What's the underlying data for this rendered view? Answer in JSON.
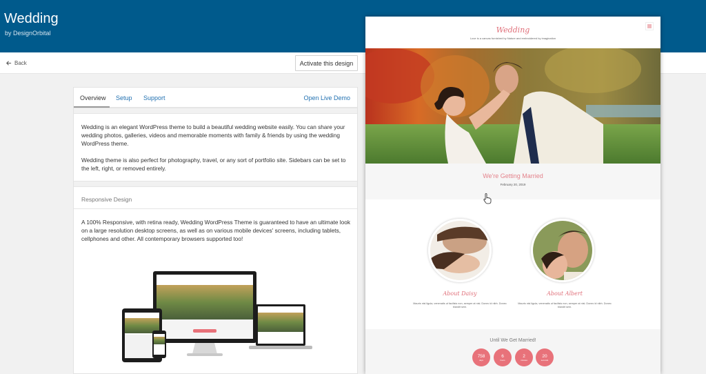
{
  "header": {
    "title": "Wedding",
    "byline": "by DesignOrbital"
  },
  "navbar": {
    "back_label": "Back",
    "activate_label": "Activate this design"
  },
  "tabs": [
    {
      "label": "Overview",
      "active": true
    },
    {
      "label": "Setup",
      "active": false
    },
    {
      "label": "Support",
      "active": false
    }
  ],
  "live_demo_label": "Open Live Demo",
  "overview": {
    "paragraph1": "Wedding is an elegant WordPress theme to build a beautiful wedding website easily. You can share your wedding photos, galleries, videos and memorable moments with family & friends by using the wedding WordPress theme.",
    "paragraph2": "Wedding theme is also perfect for photography, travel, or any sort of portfolio site. Sidebars can be set to the left, right, or removed entirely."
  },
  "responsive": {
    "heading": "Responsive Design",
    "text": "A 100% Responsive, with retina ready, Wedding WordPress Theme is guaranteed to have an ultimate look on a large resolution desktop screens, as well as on various mobile devices' screens, including tablets, cellphones and other. All contemporary browsers supported too!"
  },
  "preview": {
    "site_title": "Wedding",
    "tagline": "Love is a canvas furnished by Nature and embroidered by imagination",
    "headline": "We're Getting Married",
    "date": "February 20, 2019",
    "bride_label": "About Daisy",
    "groom_label": "About Albert",
    "bio_text": "Mauris nisl ligula, venenatis ut facilisis non, semper at nisl. Donec id nibh. Donec blandit sem.",
    "countdown_title": "Until We Get Married!",
    "countdown": [
      {
        "value": "758",
        "unit": "days"
      },
      {
        "value": "6",
        "unit": "hours"
      },
      {
        "value": "2",
        "unit": "minutes"
      },
      {
        "value": "20",
        "unit": "seconds"
      }
    ]
  },
  "colors": {
    "header_bg": "#005a8c",
    "link": "#2271b1",
    "accent": "#e8727a"
  }
}
